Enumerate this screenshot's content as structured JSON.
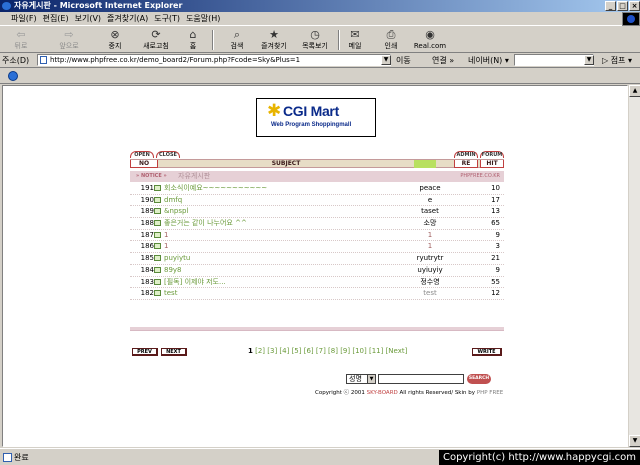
{
  "window": {
    "title": "자유게시판 - Microsoft Internet Explorer",
    "controls": {
      "minimize": "_",
      "maximize": "□",
      "close": "×"
    }
  },
  "menubar": {
    "items": [
      "파일(F)",
      "편집(E)",
      "보기(V)",
      "즐겨찾기(A)",
      "도구(T)",
      "도움말(H)"
    ]
  },
  "toolbar": {
    "buttons": [
      {
        "label": "뒤로",
        "icon": "back-arrow-icon",
        "glyph": "⇦",
        "enabled": false
      },
      {
        "label": "앞으로",
        "icon": "forward-arrow-icon",
        "glyph": "⇨",
        "enabled": false
      },
      {
        "label": "중지",
        "icon": "stop-icon",
        "glyph": "⊗",
        "enabled": true
      },
      {
        "label": "새로고침",
        "icon": "refresh-icon",
        "glyph": "⟳",
        "enabled": true
      },
      {
        "label": "홈",
        "icon": "home-icon",
        "glyph": "⌂",
        "enabled": true
      },
      {
        "label": "검색",
        "icon": "search-icon",
        "glyph": "⌕",
        "enabled": true
      },
      {
        "label": "즐겨찾기",
        "icon": "favorites-icon",
        "glyph": "★",
        "enabled": true
      },
      {
        "label": "목록보기",
        "icon": "history-icon",
        "glyph": "◷",
        "enabled": true
      },
      {
        "label": "메일",
        "icon": "mail-icon",
        "glyph": "✉",
        "enabled": true
      },
      {
        "label": "인쇄",
        "icon": "print-icon",
        "glyph": "⎙",
        "enabled": true
      },
      {
        "label": "Real.com",
        "icon": "realcom-icon",
        "glyph": "◉",
        "enabled": true
      }
    ]
  },
  "addressbar": {
    "label": "주소(D)",
    "url": "http://www.phpfree.co.kr/demo_board2/Forum.php?Fcode=Sky&Plus=1",
    "go": "이동",
    "links": "연결 »",
    "naver": "네이버(N) ▾",
    "jump": "▷ 점프 ▾"
  },
  "statusbar": {
    "text": "완료",
    "overlay": "Copyright(c) http://www.happycgi.com"
  },
  "banner": {
    "brand": "CGI Mart",
    "tagline": "Web Program Shoppingmall"
  },
  "board": {
    "tabs": {
      "open": "OPEN",
      "close": "CLOSE",
      "admin": "ADMIN",
      "forum": "FORUM"
    },
    "headers": {
      "no": "NO",
      "subject": "SUBJECT",
      "re": "RE",
      "hit": "HIT"
    },
    "notice": {
      "tag": "» NOTICE »",
      "title": "자유게시판",
      "site": "PHPFREE.CO.KR"
    },
    "rows": [
      {
        "no": "191",
        "subject": "회소식이예요~~~~~~~~~~~",
        "name": "peace",
        "hit": "10"
      },
      {
        "no": "190",
        "subject": "dmfq",
        "name": "e",
        "hit": "17"
      },
      {
        "no": "189",
        "subject": "&npspl",
        "name": "taset",
        "hit": "13"
      },
      {
        "no": "188",
        "subject": "좋은거는 같이 나누어요 ^^",
        "name": "소망",
        "hit": "65"
      },
      {
        "no": "187",
        "subject": "1",
        "name": "1",
        "hit": "9"
      },
      {
        "no": "186",
        "subject": "1",
        "name": "1",
        "hit": "3"
      },
      {
        "no": "185",
        "subject": "puyiytu",
        "name": "ryutrytr",
        "hit": "21"
      },
      {
        "no": "184",
        "subject": "89y8",
        "name": "uyiuyiy",
        "hit": "9"
      },
      {
        "no": "183",
        "subject": "[필독] 이제야 저도...",
        "name": "정수영",
        "hit": "55"
      },
      {
        "no": "182",
        "subject": "test",
        "name": "test",
        "hit": "12"
      }
    ],
    "nav": {
      "prev": "PREV",
      "next": "NEXT",
      "write": "WRITE"
    },
    "pager": [
      "1",
      "[2]",
      "[3]",
      "[4]",
      "[5]",
      "[6]",
      "[7]",
      "[8]",
      "[9]",
      "[10]",
      "[11]",
      "[Next]"
    ],
    "search": {
      "field": "성명",
      "button": "SEARCH",
      "query": ""
    },
    "copyright": {
      "prefix": "Copyright ⓒ 2001",
      "sky": "SKY-BOARD",
      "middle": "All rights Reserved/ Skin by",
      "php": "PHP FREE"
    }
  },
  "colors": {
    "title_gradient_start": "#0a246a",
    "title_gradient_end": "#a6caf0",
    "board_header": "#e7ddc6",
    "notice_bar": "#e6d0d6",
    "subject_link": "#6a9a3a",
    "accent_red": "#c04040",
    "search_button": "#c05050"
  }
}
